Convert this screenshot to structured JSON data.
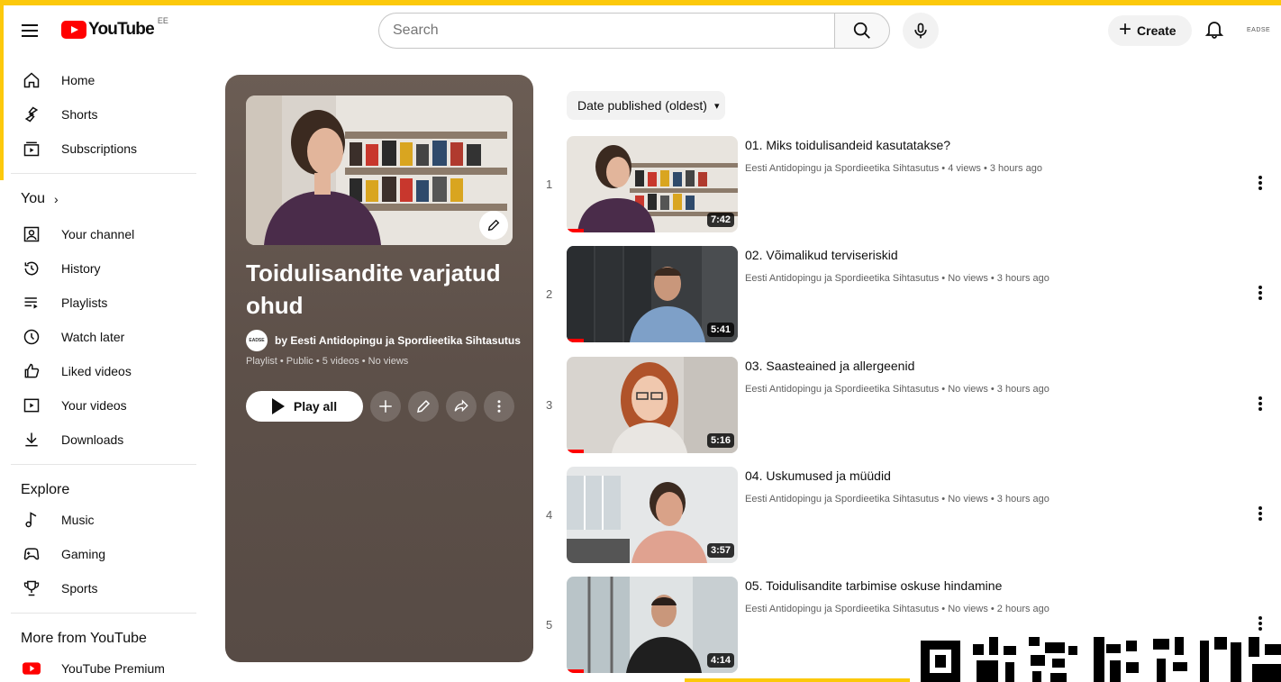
{
  "header": {
    "logo_text": "YouTube",
    "country_code": "EE",
    "search_placeholder": "Search",
    "create_label": "Create",
    "account_label": "EADSE"
  },
  "sidebar": {
    "main": [
      {
        "label": "Home",
        "icon": "home-icon"
      },
      {
        "label": "Shorts",
        "icon": "shorts-icon"
      },
      {
        "label": "Subscriptions",
        "icon": "subscriptions-icon"
      }
    ],
    "you_heading": "You",
    "you_items": [
      {
        "label": "Your channel",
        "icon": "channel-icon"
      },
      {
        "label": "History",
        "icon": "history-icon"
      },
      {
        "label": "Playlists",
        "icon": "playlists-icon"
      },
      {
        "label": "Watch later",
        "icon": "clock-icon"
      },
      {
        "label": "Liked videos",
        "icon": "thumbs-up-icon"
      },
      {
        "label": "Your videos",
        "icon": "your-videos-icon"
      },
      {
        "label": "Downloads",
        "icon": "download-icon"
      }
    ],
    "explore_heading": "Explore",
    "explore_items": [
      {
        "label": "Music",
        "icon": "music-icon"
      },
      {
        "label": "Gaming",
        "icon": "gaming-icon"
      },
      {
        "label": "Sports",
        "icon": "trophy-icon"
      }
    ],
    "more_heading": "More from YouTube",
    "more_items": [
      {
        "label": "YouTube Premium",
        "icon": "youtube-premium-icon"
      }
    ]
  },
  "playlist": {
    "title": "Toidulisandite varjatud ohud",
    "owner": "by Eesti Antidopingu ja Spordieetika Sihtasutus",
    "owner_avatar_text": "EADSE",
    "meta": "Playlist • Public • 5 videos • No views",
    "play_all_label": "Play all",
    "background_color": "#5d5049"
  },
  "sort": {
    "label": "Date published (oldest)"
  },
  "videos": [
    {
      "index": "1",
      "title": "01. Miks toidulisandeid kasutatakse?",
      "meta": "Eesti Antidopingu ja Spordieetika Sihtasutus • 4 views • 3 hours ago",
      "duration": "7:42",
      "watched": 0.1
    },
    {
      "index": "2",
      "title": "02. Võimalikud terviseriskid",
      "meta": "Eesti Antidopingu ja Spordieetika Sihtasutus • No views • 3 hours ago",
      "duration": "5:41",
      "watched": 0.1
    },
    {
      "index": "3",
      "title": "03. Saasteained ja allergeenid",
      "meta": "Eesti Antidopingu ja Spordieetika Sihtasutus • No views • 3 hours ago",
      "duration": "5:16",
      "watched": 0.1
    },
    {
      "index": "4",
      "title": "04. Uskumused ja müüdid",
      "meta": "Eesti Antidopingu ja Spordieetika Sihtasutus • No views • 3 hours ago",
      "duration": "3:57",
      "watched": 0
    },
    {
      "index": "5",
      "title": "05. Toidulisandite tarbimise oskuse hindamine",
      "meta": "Eesti Antidopingu ja Spordieetika Sihtasutus • No views • 2 hours ago",
      "duration": "4:14",
      "watched": 0.1
    }
  ]
}
